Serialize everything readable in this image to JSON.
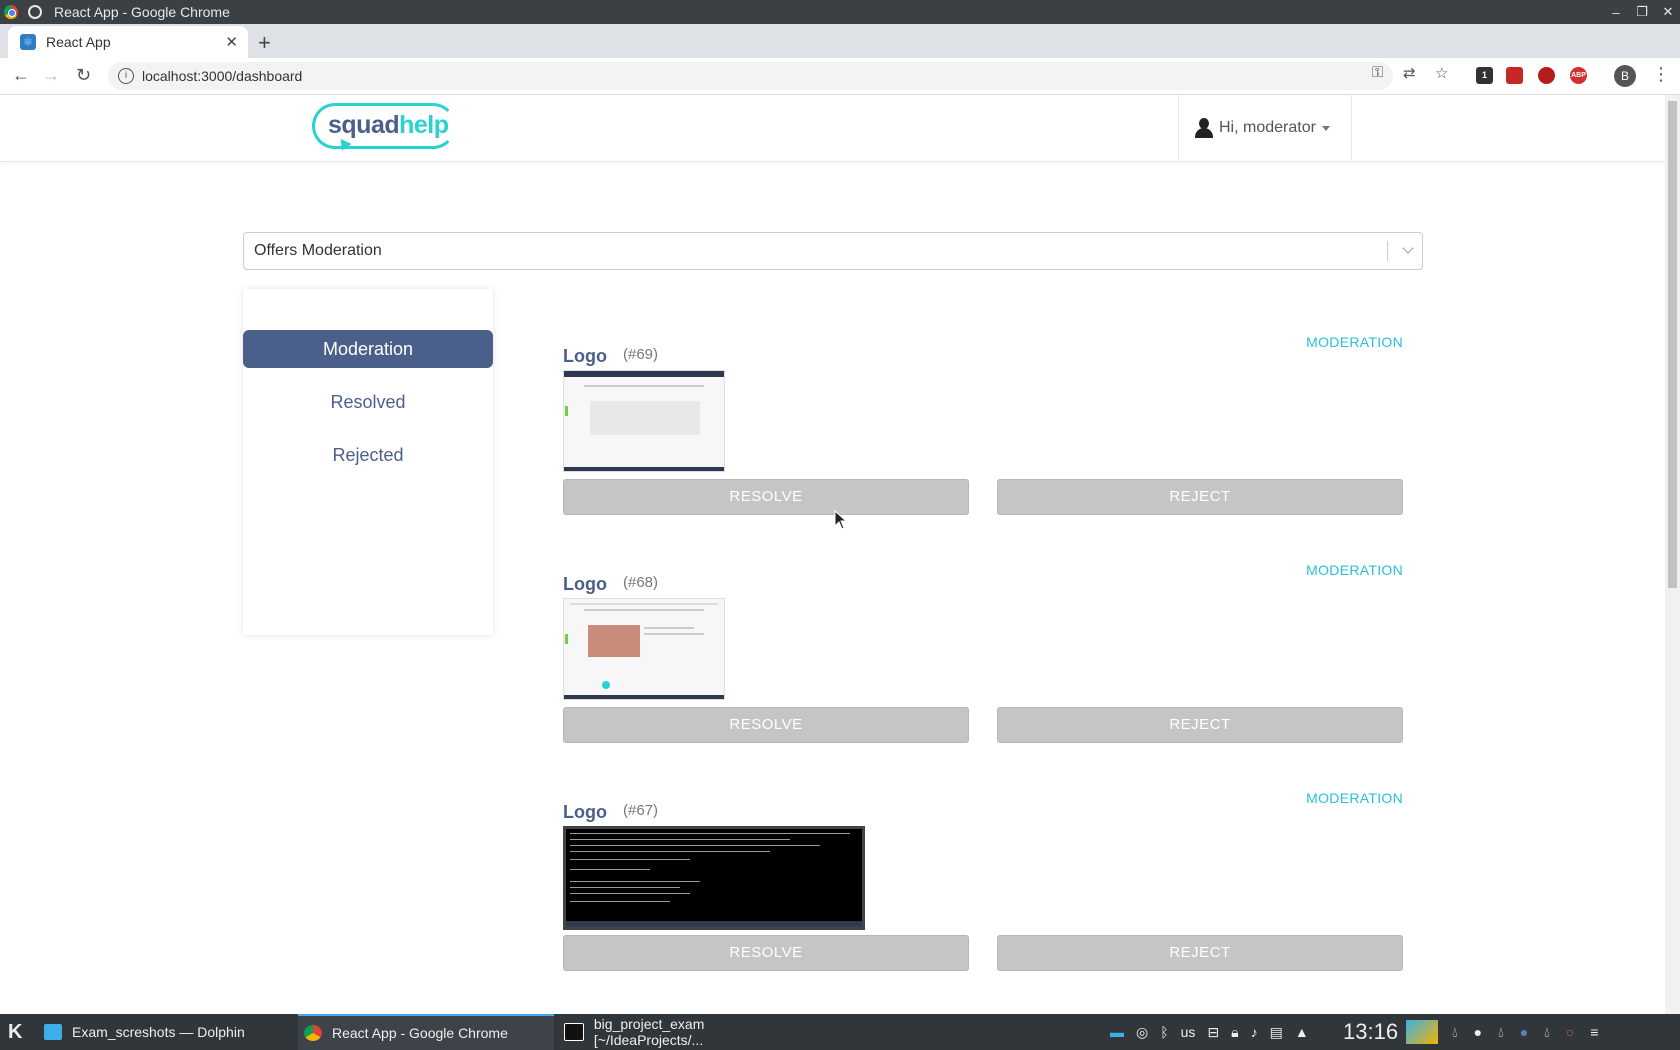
{
  "window": {
    "title": "React App - Google Chrome",
    "controls": [
      "–",
      "❐",
      "✕"
    ]
  },
  "browser": {
    "tab_title": "React App",
    "tab_close": "✕",
    "new_tab": "+",
    "url": "localhost:3000/dashboard",
    "extensions": [
      {
        "name": "mailbox-extension",
        "color": "#333",
        "label": "1"
      },
      {
        "name": "pdf-extension",
        "color": "#c62828",
        "label": ""
      },
      {
        "name": "download-extension",
        "color": "#b71c1c",
        "label": ""
      },
      {
        "name": "adblock-extension",
        "color": "#d32f2f",
        "label": "ABP"
      }
    ],
    "profile_initial": "B"
  },
  "header": {
    "logo_squad": "squad",
    "logo_help": "help",
    "user_greeting": "Hi, moderator"
  },
  "filter": {
    "selected": "Offers Moderation"
  },
  "sidebar": {
    "items": [
      {
        "label": "Moderation",
        "active": true
      },
      {
        "label": "Resolved",
        "active": false
      },
      {
        "label": "Rejected",
        "active": false
      }
    ]
  },
  "offers": [
    {
      "type": "Logo",
      "id": "(#69)",
      "status": "MODERATION",
      "resolve": "RESOLVE",
      "reject": "REJECT",
      "thumbnail": "website-screenshot"
    },
    {
      "type": "Logo",
      "id": "(#68)",
      "status": "MODERATION",
      "resolve": "RESOLVE",
      "reject": "REJECT",
      "thumbnail": "website-screenshot"
    },
    {
      "type": "Logo",
      "id": "(#67)",
      "status": "MODERATION",
      "resolve": "RESOLVE",
      "reject": "REJECT",
      "thumbnail": "terminal-screenshot"
    }
  ],
  "taskbar": {
    "tasks": [
      {
        "label": "Exam_screshots — Dolphin",
        "icon": "folder-icon",
        "active": false
      },
      {
        "label": "React App - Google Chrome",
        "icon": "chrome-icon",
        "active": true
      },
      {
        "label": "big_project_exam [~/IdeaProjects/...",
        "icon": "intellij-icon",
        "active": false
      }
    ],
    "keyboard_layout": "us",
    "clock": "13:16"
  },
  "colors": {
    "brand_dark": "#4a5f8a",
    "brand_accent": "#28d2d0",
    "status": "#28c0d6",
    "button": "#c4c5c7"
  }
}
